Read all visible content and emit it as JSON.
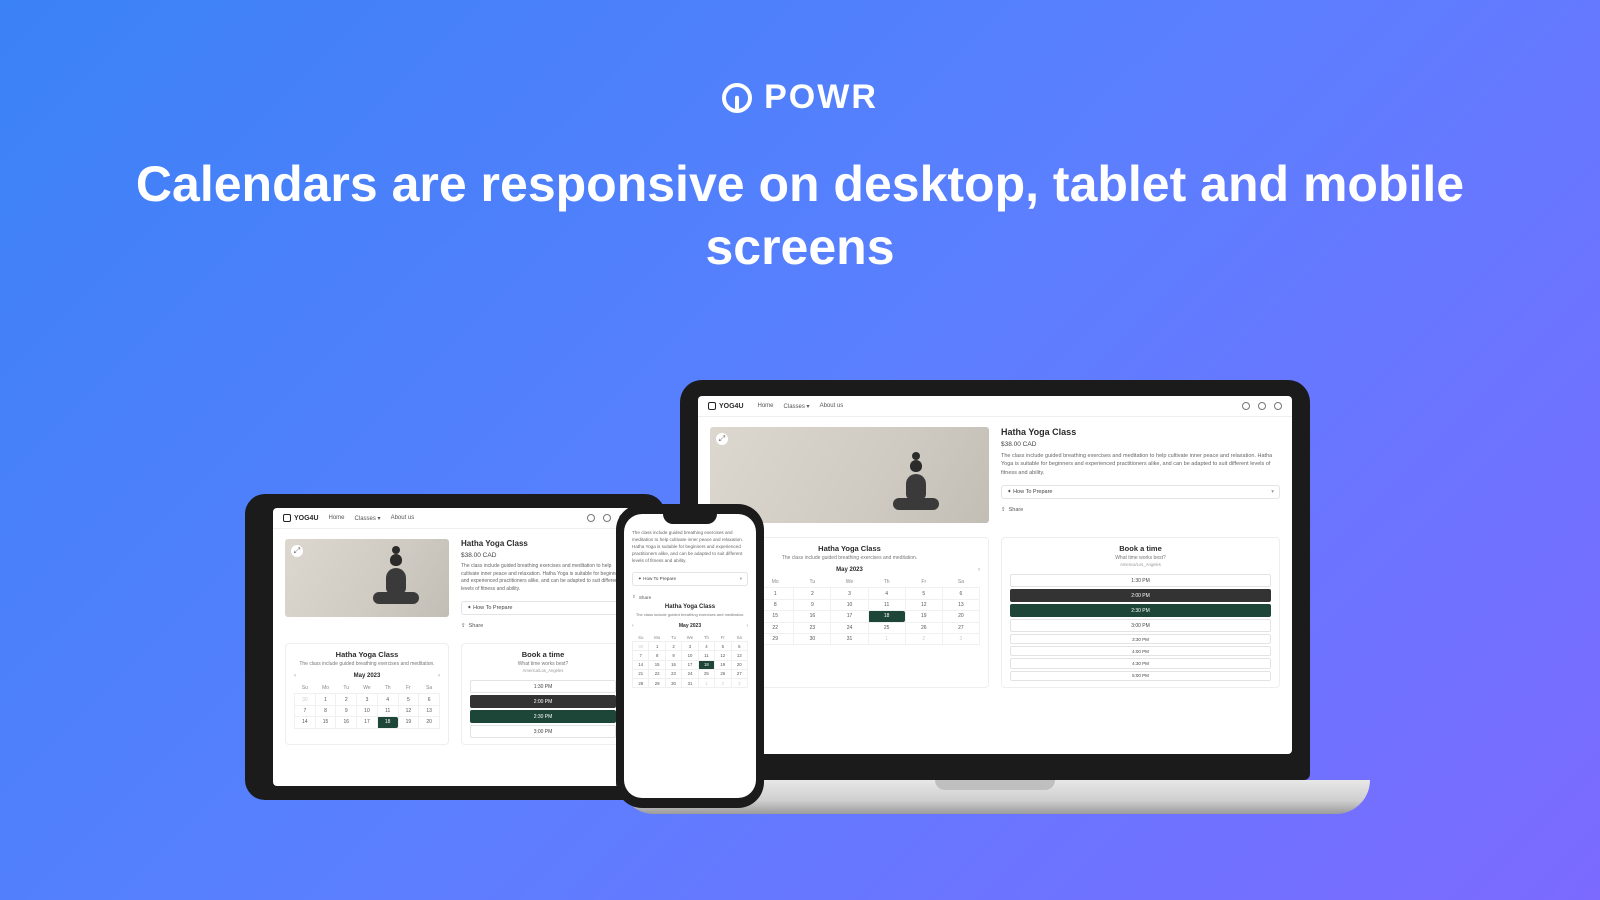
{
  "brand": "POWR",
  "headline": "Calendars are responsive on desktop, tablet and mobile screens",
  "site": {
    "name": "YOG4U",
    "nav": [
      "Home",
      "Classes",
      "About us"
    ]
  },
  "product": {
    "title": "Hatha Yoga Class",
    "price": "$38.00 CAD",
    "description": "The class include guided breathing exercises and meditation to help cultivate inner peace and relaxation. Hatha Yoga is suitable for beginners and experienced practitioners alike, and can be adapted to suit different levels of fitness and ability.",
    "accordion": "How To Prepare",
    "share": "Share"
  },
  "calendar": {
    "title": "Hatha Yoga Class",
    "subtitle": "The class include guided breathing exercises and meditation.",
    "month": "May 2023",
    "weekdays": [
      "Su",
      "Mo",
      "Tu",
      "We",
      "Th",
      "Fr",
      "Sa"
    ],
    "grid": [
      [
        "30",
        "1",
        "2",
        "3",
        "4",
        "5",
        "6"
      ],
      [
        "7",
        "8",
        "9",
        "10",
        "11",
        "12",
        "13"
      ],
      [
        "14",
        "15",
        "16",
        "17",
        "18",
        "19",
        "20"
      ],
      [
        "21",
        "22",
        "23",
        "24",
        "25",
        "26",
        "27"
      ],
      [
        "28",
        "29",
        "30",
        "31",
        "1",
        "2",
        "3"
      ]
    ],
    "selected": "18"
  },
  "booking": {
    "title": "Book a time",
    "prompt": "What time works best?",
    "tz": "America/Los_Angeles",
    "slots_laptop": [
      "1:30 PM",
      "2:00 PM",
      "2:30 PM",
      "3:00 PM",
      "3:30 PM",
      "4:00 PM",
      "4:30 PM",
      "5:00 PM"
    ],
    "slots_tablet": [
      "1:30 PM",
      "2:00 PM",
      "2:30 PM",
      "3:00 PM"
    ]
  }
}
